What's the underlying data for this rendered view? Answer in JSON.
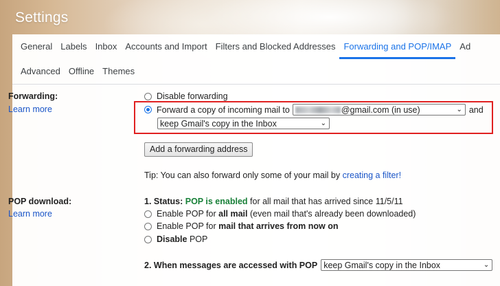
{
  "header": {
    "title": "Settings"
  },
  "tabs_row1": [
    "General",
    "Labels",
    "Inbox",
    "Accounts and Import",
    "Filters and Blocked Addresses",
    "Forwarding and POP/IMAP",
    "Ad"
  ],
  "tabs_row2": [
    "Advanced",
    "Offline",
    "Themes"
  ],
  "forwarding": {
    "label": "Forwarding:",
    "learn_more": "Learn more",
    "disable_label": "Disable forwarding",
    "forward_label": "Forward a copy of incoming mail to",
    "forward_address_suffix": "@gmail.com (in use)",
    "and_label": "and",
    "copy_option": "keep Gmail's copy in the Inbox",
    "add_button": "Add a forwarding address",
    "tip_prefix": "Tip: You can also forward only some of your mail by",
    "tip_link": "creating a filter!"
  },
  "pop": {
    "label": "POP download:",
    "learn_more": "Learn more",
    "status_prefix": "1. Status:",
    "status_enabled": "POP is enabled",
    "status_suffix": "for all mail that has arrived since 11/5/11",
    "opt_all_prefix": "Enable POP for",
    "opt_all_bold": "all mail",
    "opt_all_suffix": "(even mail that's already been downloaded)",
    "opt_new_prefix": "Enable POP for",
    "opt_new_bold": "mail that arrives from now on",
    "opt_disable_bold": "Disable",
    "opt_disable_suffix": "POP",
    "when_label": "2. When messages are accessed with POP",
    "when_option": "keep Gmail's copy in the Inbox"
  },
  "colors": {
    "accent": "#1a73e8",
    "link": "#1a55c7",
    "highlight_box": "#e02020",
    "status_green": "#188038"
  }
}
